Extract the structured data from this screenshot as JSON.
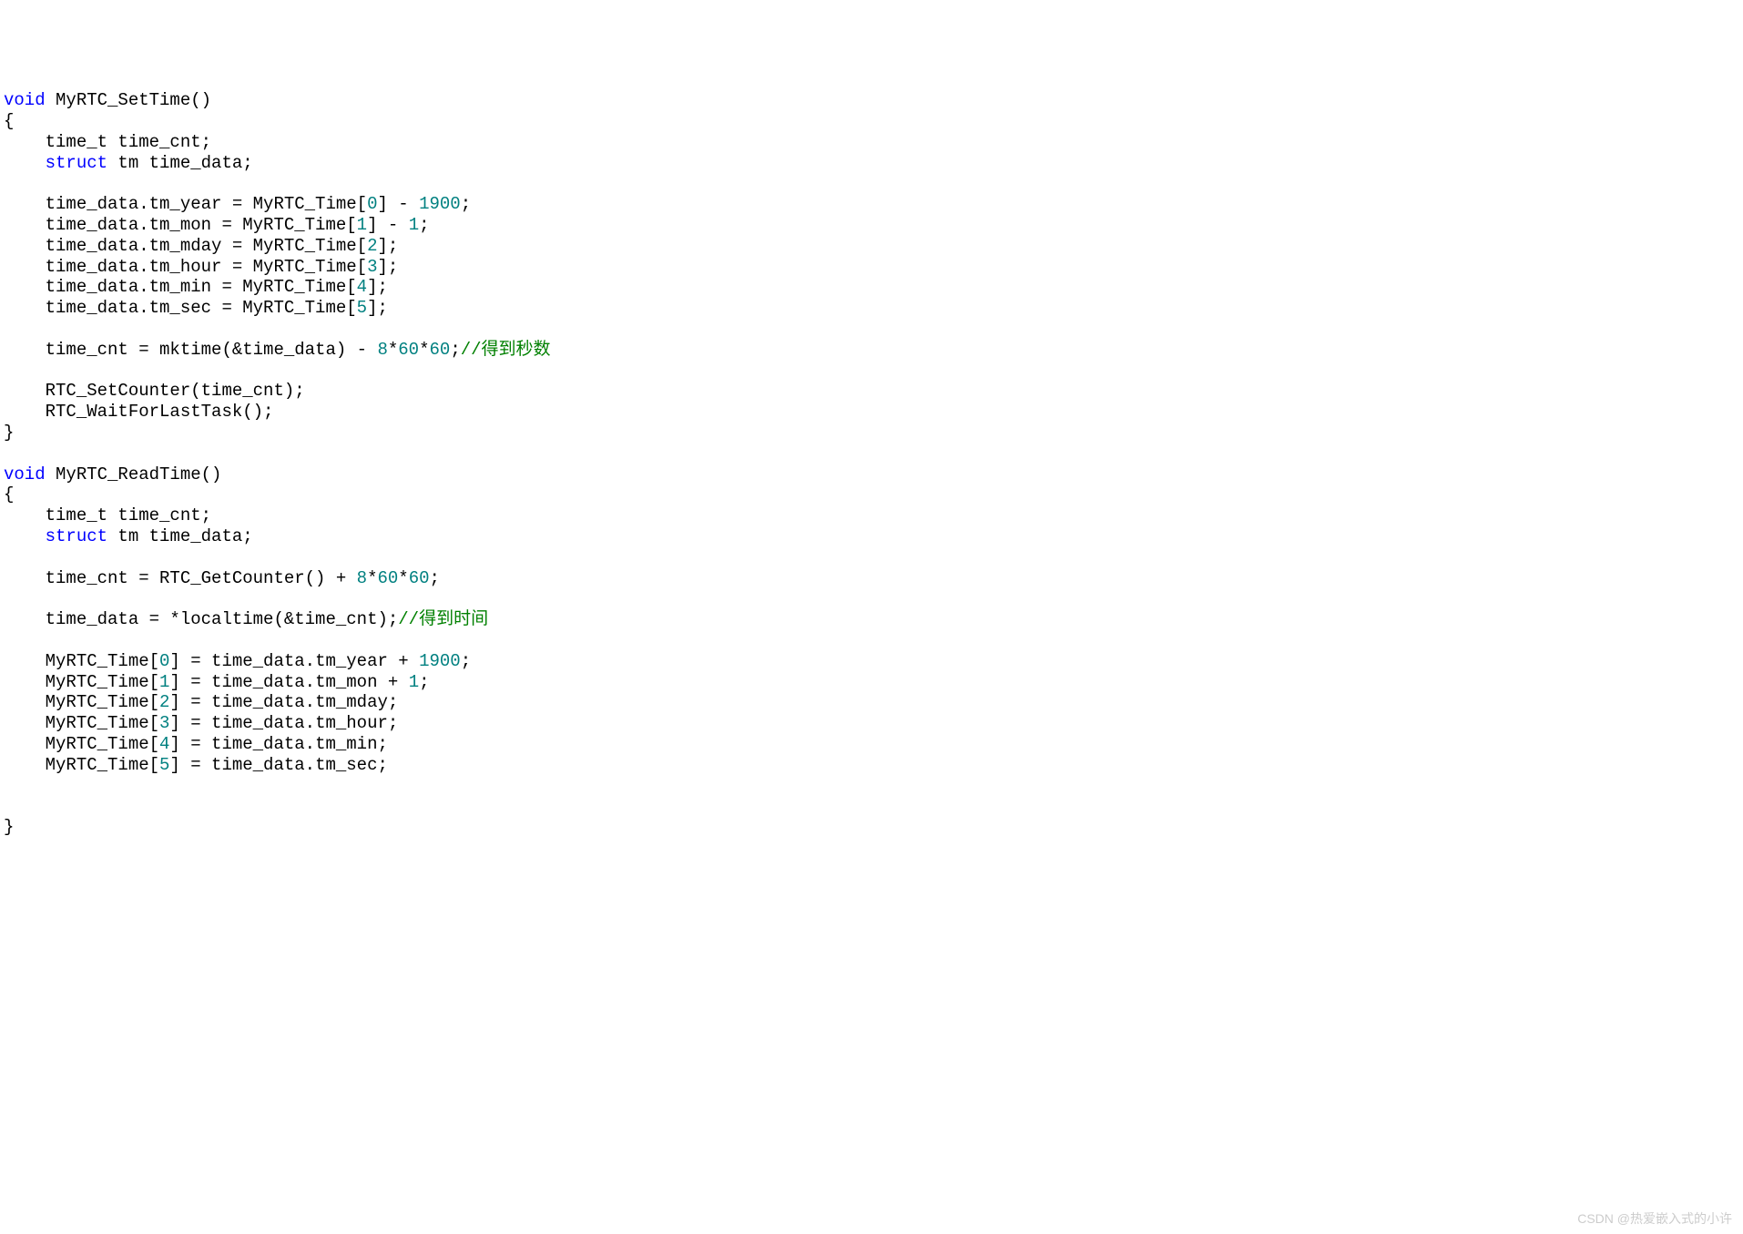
{
  "code": {
    "l1_kw1": "void",
    "l1_rest": " MyRTC_SetTime()",
    "l2": "{",
    "l3": "    time_t time_cnt;",
    "l4_pre": "    ",
    "l4_kw": "struct",
    "l4_rest": " tm time_data;",
    "l5": "",
    "l6_pre": "    time_data.tm_year = MyRTC_Time[",
    "l6_n1": "0",
    "l6_mid": "] - ",
    "l6_n2": "1900",
    "l6_end": ";",
    "l7_pre": "    time_data.tm_mon = MyRTC_Time[",
    "l7_n1": "1",
    "l7_mid": "] - ",
    "l7_n2": "1",
    "l7_end": ";",
    "l8_pre": "    time_data.tm_mday = MyRTC_Time[",
    "l8_n1": "2",
    "l8_end": "];",
    "l9_pre": "    time_data.tm_hour = MyRTC_Time[",
    "l9_n1": "3",
    "l9_end": "];",
    "l10_pre": "    time_data.tm_min = MyRTC_Time[",
    "l10_n1": "4",
    "l10_end": "];",
    "l11_pre": "    time_data.tm_sec = MyRTC_Time[",
    "l11_n1": "5",
    "l11_end": "];",
    "l12": "",
    "l13_pre": "    time_cnt = mktime(&time_data) - ",
    "l13_n1": "8",
    "l13_m1": "*",
    "l13_n2": "60",
    "l13_m2": "*",
    "l13_n3": "60",
    "l13_sc": ";",
    "l13_cm": "//得到秒数",
    "l14": "",
    "l15": "    RTC_SetCounter(time_cnt);",
    "l16": "    RTC_WaitForLastTask();",
    "l17": "}",
    "l18": "",
    "l19_kw1": "void",
    "l19_rest": " MyRTC_ReadTime()",
    "l20": "{",
    "l21": "    time_t time_cnt;",
    "l22_pre": "    ",
    "l22_kw": "struct",
    "l22_rest": " tm time_data;",
    "l23": "",
    "l24_pre": "    time_cnt = RTC_GetCounter() + ",
    "l24_n1": "8",
    "l24_m1": "*",
    "l24_n2": "60",
    "l24_m2": "*",
    "l24_n3": "60",
    "l24_end": ";",
    "l25": "",
    "l26_pre": "    time_data = *localtime(&time_cnt);",
    "l26_cm": "//得到时间",
    "l27": "",
    "l28_pre": "    MyRTC_Time[",
    "l28_n1": "0",
    "l28_mid": "] = time_data.tm_year + ",
    "l28_n2": "1900",
    "l28_end": ";",
    "l29_pre": "    MyRTC_Time[",
    "l29_n1": "1",
    "l29_mid": "] = time_data.tm_mon + ",
    "l29_n2": "1",
    "l29_end": ";",
    "l30_pre": "    MyRTC_Time[",
    "l30_n1": "2",
    "l30_end": "] = time_data.tm_mday;",
    "l31_pre": "    MyRTC_Time[",
    "l31_n1": "3",
    "l31_end": "] = time_data.tm_hour;",
    "l32_pre": "    MyRTC_Time[",
    "l32_n1": "4",
    "l32_end": "] = time_data.tm_min;",
    "l33_pre": "    MyRTC_Time[",
    "l33_n1": "5",
    "l33_end": "] = time_data.tm_sec;",
    "l34": "",
    "l35": "",
    "l36": "}"
  },
  "watermark": "CSDN @热爱嵌入式的小许"
}
